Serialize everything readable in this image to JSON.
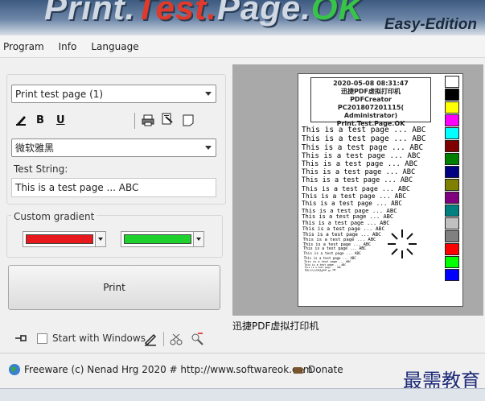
{
  "banner": {
    "title_part1": "Print.",
    "title_part2": "Test.",
    "title_part3": "Page.",
    "title_part4": "OK",
    "edition": "Easy-Edition"
  },
  "menu": {
    "items": [
      "Program",
      "Info",
      "Language"
    ]
  },
  "left": {
    "page_select": "Print test page (1)",
    "format_bold": "B",
    "format_underline": "U",
    "font_select": "微软雅黑",
    "test_string_label": "Test String:",
    "test_string_value": "This is a test page ... ABC",
    "gradient_label": "Custom gradient",
    "gradient_color1": "#e8191c",
    "gradient_color2": "#1fd12d",
    "print_label": "Print",
    "start_with_windows": "Start with Windows"
  },
  "preview": {
    "header_lines": [
      "2020-05-08 08:31:47",
      "迅捷PDF虚拟打印机",
      "PDFCreator",
      "PC20180720111​5( Administrator)",
      "Print.Test.Page.OK"
    ],
    "test_line": "This is a test page ... ABC",
    "colors": [
      "#ffffff",
      "#000000",
      "#ffff00",
      "#ff00ff",
      "#00ffff",
      "#800000",
      "#008000",
      "#000080",
      "#808000",
      "#800080",
      "#008080",
      "#c0c0c0",
      "#808080",
      "#ff0000",
      "#00ff00",
      "#0000ff"
    ],
    "printer_name": "迅捷PDF虚拟打印机"
  },
  "status": {
    "freeware": "Freeware (c) Nenad Hrg 2020 # http://www.softwareok.com",
    "donate": "Donate"
  },
  "watermark": "最需教育"
}
